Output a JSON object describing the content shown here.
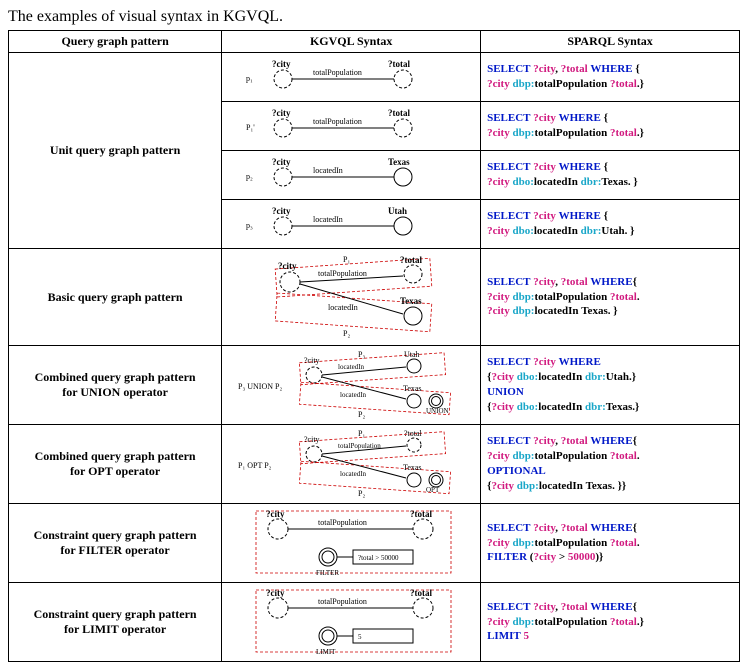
{
  "title": "The examples of visual syntax in KGVQL.",
  "headers": {
    "c1": "Query graph pattern",
    "c2": "KGVQL Syntax",
    "c3": "SPARQL Syntax"
  },
  "rows": [
    {
      "name": "Unit query graph pattern",
      "sub": [
        {
          "pid": "p1_label",
          "p": "p₁",
          "left": "?city",
          "llbl": "city_q",
          "right": "?total",
          "rlbl": "total_q",
          "edge": "totalPopulation",
          "dashLeft": true,
          "dashRight": true,
          "sparql": [
            [
              "kw",
              "SELECT"
            ],
            [
              "sp",
              " "
            ],
            [
              "var",
              "?city"
            ],
            [
              "txt",
              ", "
            ],
            [
              "var",
              "?total"
            ],
            [
              "sp",
              " "
            ],
            [
              "kw",
              "WHERE"
            ],
            [
              "sp",
              " "
            ],
            [
              "txt",
              "{"
            ],
            [
              "br"
            ],
            [
              "var",
              "?city"
            ],
            [
              "sp",
              " "
            ],
            [
              "pre",
              "dbp:"
            ],
            [
              "pred",
              "totalPopulation"
            ],
            [
              "sp",
              " "
            ],
            [
              "var",
              "?total"
            ],
            [
              "txt",
              ".}"
            ]
          ]
        },
        {
          "pid": "p1p_label",
          "p": "P₁'",
          "left": "?city",
          "right": "?total",
          "edge": "totalPopulation",
          "dashLeft": true,
          "dashRight": true,
          "sparql": [
            [
              "kw",
              "SELECT"
            ],
            [
              "sp",
              " "
            ],
            [
              "var",
              "?city"
            ],
            [
              "sp",
              " "
            ],
            [
              "kw",
              "WHERE"
            ],
            [
              "sp",
              " "
            ],
            [
              "txt",
              "{"
            ],
            [
              "br"
            ],
            [
              "var",
              "?city"
            ],
            [
              "sp",
              " "
            ],
            [
              "pre",
              "dbp:"
            ],
            [
              "pred",
              "totalPopulation"
            ],
            [
              "sp",
              " "
            ],
            [
              "var",
              "?total"
            ],
            [
              "txt",
              ".}"
            ]
          ]
        },
        {
          "pid": "p2_label",
          "p": "p₂",
          "left": "?city",
          "right": "Texas",
          "edge": "locatedIn",
          "dashLeft": true,
          "dashRight": false,
          "sparql": [
            [
              "kw",
              "SELECT"
            ],
            [
              "sp",
              " "
            ],
            [
              "var",
              "?city"
            ],
            [
              "sp",
              " "
            ],
            [
              "kw",
              "WHERE"
            ],
            [
              "sp",
              " "
            ],
            [
              "txt",
              "{"
            ],
            [
              "br"
            ],
            [
              "var",
              "?city"
            ],
            [
              "sp",
              " "
            ],
            [
              "pre",
              "dbo:"
            ],
            [
              "pred",
              "locatedIn"
            ],
            [
              "sp",
              " "
            ],
            [
              "pre",
              "dbr:"
            ],
            [
              "pred",
              "Texas"
            ],
            [
              "txt",
              ". }"
            ]
          ]
        },
        {
          "pid": "p3_label",
          "p": "p₃",
          "left": "?city",
          "right": "Utah",
          "edge": "locatedIn",
          "dashLeft": true,
          "dashRight": false,
          "sparql": [
            [
              "kw",
              "SELECT"
            ],
            [
              "sp",
              " "
            ],
            [
              "var",
              "?city"
            ],
            [
              "sp",
              " "
            ],
            [
              "kw",
              "WHERE"
            ],
            [
              "sp",
              " "
            ],
            [
              "txt",
              "{"
            ],
            [
              "br"
            ],
            [
              "var",
              "?city"
            ],
            [
              "sp",
              " "
            ],
            [
              "pre",
              "dbo:"
            ],
            [
              "pred",
              "locatedIn"
            ],
            [
              "sp",
              " "
            ],
            [
              "pre",
              "dbr:"
            ],
            [
              "pred",
              "Utah"
            ],
            [
              "txt",
              ". }"
            ]
          ]
        }
      ]
    },
    {
      "name": "Basic query graph pattern",
      "diagram": "basic",
      "labels": {
        "p1": "P₁",
        "p2": "P₂",
        "city": "?city",
        "total": "?total",
        "texas": "Texas",
        "e1": "totalPopulation",
        "e2": "locatedIn"
      },
      "sparql": [
        [
          "kw",
          "SELECT"
        ],
        [
          "sp",
          " "
        ],
        [
          "var",
          "?city"
        ],
        [
          "txt",
          ", "
        ],
        [
          "var",
          "?total"
        ],
        [
          "sp",
          " "
        ],
        [
          "kw",
          "WHERE"
        ],
        [
          "txt",
          "{"
        ],
        [
          "br"
        ],
        [
          "var",
          "?city"
        ],
        [
          "sp",
          " "
        ],
        [
          "pre",
          "dbp:"
        ],
        [
          "pred",
          "totalPopulation"
        ],
        [
          "sp",
          " "
        ],
        [
          "var",
          "?total"
        ],
        [
          "txt",
          "."
        ],
        [
          "br"
        ],
        [
          "var",
          "?city"
        ],
        [
          "sp",
          " "
        ],
        [
          "pre",
          "dbp:"
        ],
        [
          "pred",
          "locatedIn"
        ],
        [
          "sp",
          " "
        ],
        [
          "pred",
          "Texas"
        ],
        [
          "txt",
          ". }"
        ]
      ]
    },
    {
      "name": "Combined query graph pattern for UNION operator",
      "diagram": "union",
      "labels": {
        "op": "P₃ UNION P₂",
        "p3": "P₃",
        "p2": "P₂",
        "city": "?city",
        "utah": "Utah",
        "texas": "Texas",
        "e": "locatedIn",
        "tag": "UNION"
      },
      "sparql": [
        [
          "kw",
          "SELECT"
        ],
        [
          "sp",
          " "
        ],
        [
          "var",
          "?city"
        ],
        [
          "sp",
          " "
        ],
        [
          "kw",
          "WHERE"
        ],
        [
          "br"
        ],
        [
          "txt",
          "{"
        ],
        [
          "var",
          "?city"
        ],
        [
          "sp",
          " "
        ],
        [
          "pre",
          "dbo:"
        ],
        [
          "pred",
          "locatedIn"
        ],
        [
          "sp",
          " "
        ],
        [
          "pre",
          "dbr:"
        ],
        [
          "pred",
          "Utah"
        ],
        [
          "txt",
          ".}"
        ],
        [
          "br"
        ],
        [
          "kw",
          "UNION"
        ],
        [
          "br"
        ],
        [
          "txt",
          "{"
        ],
        [
          "var",
          "?city"
        ],
        [
          "sp",
          " "
        ],
        [
          "pre",
          "dbo:"
        ],
        [
          "pred",
          "locatedIn"
        ],
        [
          "sp",
          " "
        ],
        [
          "pre",
          "dbr:"
        ],
        [
          "pred",
          "Texas"
        ],
        [
          "txt",
          ".}"
        ]
      ]
    },
    {
      "name": "Combined query graph pattern for OPT operator",
      "diagram": "opt",
      "labels": {
        "op": "P₁ OPT P₂",
        "p1": "P₁",
        "p2": "P₂",
        "city": "?city",
        "total": "?total",
        "texas": "Texas",
        "e1": "totalPopulation",
        "e2": "locatedIn",
        "tag": "OPT"
      },
      "sparql": [
        [
          "kw",
          "SELECT"
        ],
        [
          "sp",
          " "
        ],
        [
          "var",
          "?city"
        ],
        [
          "txt",
          ", "
        ],
        [
          "var",
          "?total"
        ],
        [
          "sp",
          " "
        ],
        [
          "kw",
          "WHERE"
        ],
        [
          "txt",
          "{"
        ],
        [
          "br"
        ],
        [
          "var",
          "?city"
        ],
        [
          "sp",
          " "
        ],
        [
          "pre",
          "dbp:"
        ],
        [
          "pred",
          "totalPopulation"
        ],
        [
          "sp",
          " "
        ],
        [
          "var",
          "?total"
        ],
        [
          "txt",
          "."
        ],
        [
          "br"
        ],
        [
          "kw",
          "OPTIONAL"
        ],
        [
          "br"
        ],
        [
          "txt",
          "{"
        ],
        [
          "var",
          "?city"
        ],
        [
          "sp",
          " "
        ],
        [
          "pre",
          "dbp:"
        ],
        [
          "pred",
          "locatedIn"
        ],
        [
          "sp",
          " "
        ],
        [
          "pred",
          "Texas"
        ],
        [
          "txt",
          ". }}"
        ]
      ]
    },
    {
      "name": "Constraint query graph pattern for FILTER operator",
      "diagram": "filter",
      "labels": {
        "city": "?city",
        "total": "?total",
        "e": "totalPopulation",
        "cond": "?total > 50000",
        "tag": "FILTER"
      },
      "sparql": [
        [
          "kw",
          "SELECT"
        ],
        [
          "sp",
          " "
        ],
        [
          "var",
          "?city"
        ],
        [
          "txt",
          ", "
        ],
        [
          "var",
          "?total"
        ],
        [
          "sp",
          " "
        ],
        [
          "kw",
          "WHERE"
        ],
        [
          "txt",
          "{"
        ],
        [
          "br"
        ],
        [
          "var",
          "?city"
        ],
        [
          "sp",
          " "
        ],
        [
          "pre",
          "dbp:"
        ],
        [
          "pred",
          "totalPopulation"
        ],
        [
          "sp",
          " "
        ],
        [
          "var",
          "?total"
        ],
        [
          "txt",
          "."
        ],
        [
          "br"
        ],
        [
          "kw",
          "FILTER"
        ],
        [
          "sp",
          " "
        ],
        [
          "txt",
          "("
        ],
        [
          "var",
          "?city"
        ],
        [
          "txt",
          " > "
        ],
        [
          "lit",
          "50000"
        ],
        [
          "txt",
          ")}"
        ]
      ]
    },
    {
      "name": "Constraint query graph pattern for LIMIT operator",
      "diagram": "limit",
      "labels": {
        "city": "?city",
        "total": "?total",
        "e": "totalPopulation",
        "cond": "5",
        "tag": "LIMIT"
      },
      "sparql": [
        [
          "kw",
          "SELECT"
        ],
        [
          "sp",
          " "
        ],
        [
          "var",
          "?city"
        ],
        [
          "txt",
          ", "
        ],
        [
          "var",
          "?total"
        ],
        [
          "sp",
          " "
        ],
        [
          "kw",
          "WHERE"
        ],
        [
          "txt",
          "{"
        ],
        [
          "br"
        ],
        [
          "var",
          "?city"
        ],
        [
          "sp",
          " "
        ],
        [
          "pre",
          "dbp:"
        ],
        [
          "pred",
          "totalPopulation"
        ],
        [
          "sp",
          " "
        ],
        [
          "var",
          "?total"
        ],
        [
          "txt",
          ".}"
        ],
        [
          "br"
        ],
        [
          "kw",
          "LIMIT"
        ],
        [
          "sp",
          " "
        ],
        [
          "lit",
          "5"
        ]
      ]
    }
  ]
}
